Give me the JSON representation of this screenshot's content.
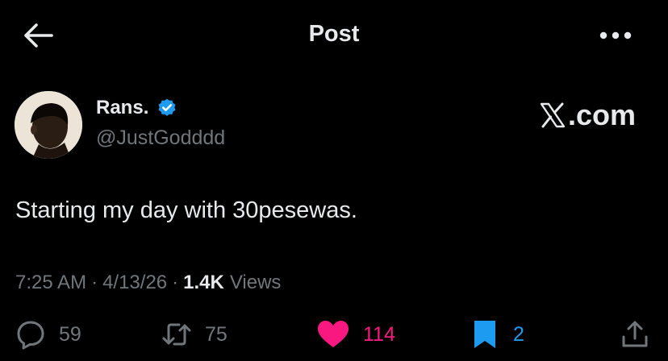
{
  "header": {
    "title": "Post",
    "back_icon": "arrow-left-icon",
    "more_icon": "more-horizontal-icon"
  },
  "author": {
    "display_name": "Rans.",
    "handle": "@JustGodddd",
    "verified": true,
    "verified_color": "#1d9bf0"
  },
  "brand": {
    "label": ".com",
    "mark": "X"
  },
  "post": {
    "text": "Starting my day with 30pesewas.",
    "time": "7:25 AM",
    "date": "4/13/26",
    "views_count": "1.4K",
    "views_label": "Views"
  },
  "actions": {
    "replies": "59",
    "reposts": "75",
    "likes": "114",
    "bookmarks": "2",
    "like_color": "#f91880",
    "bookmark_color": "#1d9bf0"
  }
}
